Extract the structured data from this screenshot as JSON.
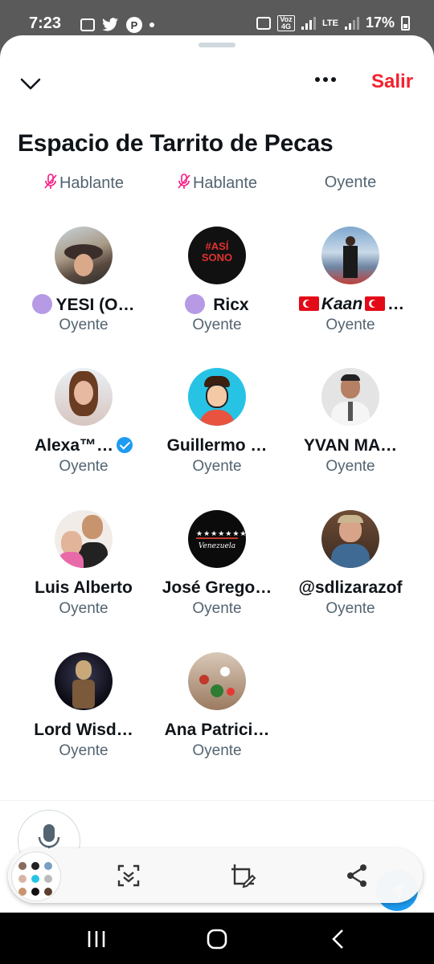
{
  "status_bar": {
    "time": "7:23",
    "network": "LTE",
    "volte": "Voz 4G",
    "battery": "17%"
  },
  "header": {
    "leave_label": "Salir",
    "title": "Espacio de Tarrito de Pecas"
  },
  "top_roles": [
    "Hablante",
    "Hablante",
    "Oyente"
  ],
  "participants": [
    {
      "name": "YESI (O…",
      "role": "Oyente",
      "prefix": "purple-dot"
    },
    {
      "name": "Ricx",
      "role": "Oyente",
      "prefix": "purple-dot"
    },
    {
      "name": "Kaan",
      "suffix": "…",
      "role": "Oyente",
      "prefix": "turkey-flag"
    },
    {
      "name": "Alexa™…",
      "role": "Oyente",
      "verified": true
    },
    {
      "name": "Guillermo …",
      "role": "Oyente"
    },
    {
      "name": "YVAN MA…",
      "role": "Oyente"
    },
    {
      "name": "Luis Alberto",
      "role": "Oyente"
    },
    {
      "name": "José Grego…",
      "role": "Oyente"
    },
    {
      "name": "@sdlizarazof",
      "role": "Oyente"
    },
    {
      "name": "Lord Wisd…",
      "role": "Oyente"
    },
    {
      "name": "Ana Patrici…",
      "role": "Oyente"
    }
  ],
  "avatar_art": {
    "ricx_text": "#ASÍ SONO",
    "jose_text": "Venezuela"
  },
  "colors": {
    "accent_red": "#f4212e",
    "twitter_blue": "#1d9bf0",
    "text_primary": "#0f1419",
    "text_secondary": "#536471"
  }
}
